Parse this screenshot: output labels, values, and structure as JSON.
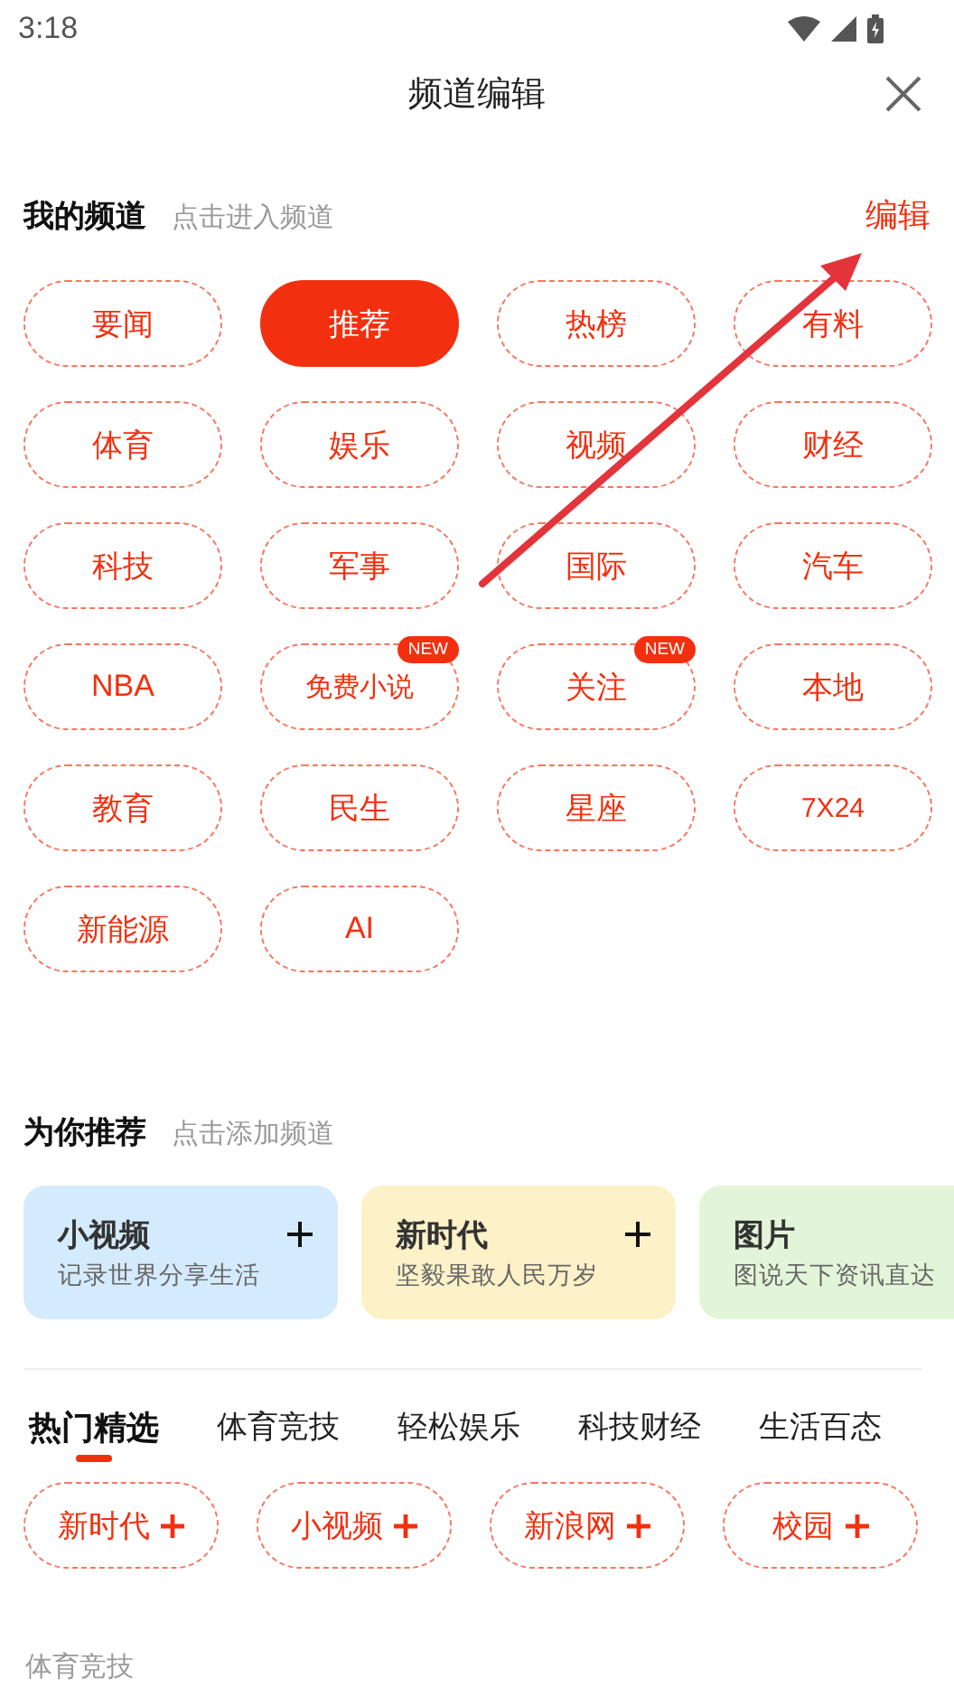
{
  "status_bar": {
    "time": "3:18"
  },
  "header": {
    "title": "频道编辑"
  },
  "my_channels": {
    "title": "我的频道",
    "hint": "点击进入频道",
    "edit": "编辑",
    "items": [
      {
        "label": "要闻",
        "selected": false
      },
      {
        "label": "推荐",
        "selected": true
      },
      {
        "label": "热榜",
        "selected": false
      },
      {
        "label": "有料",
        "selected": false
      },
      {
        "label": "体育",
        "selected": false
      },
      {
        "label": "娱乐",
        "selected": false
      },
      {
        "label": "视频",
        "selected": false
      },
      {
        "label": "财经",
        "selected": false
      },
      {
        "label": "科技",
        "selected": false
      },
      {
        "label": "军事",
        "selected": false
      },
      {
        "label": "国际",
        "selected": false
      },
      {
        "label": "汽车",
        "selected": false
      },
      {
        "label": "NBA",
        "selected": false
      },
      {
        "label": "免费小说",
        "selected": false,
        "badge": "NEW"
      },
      {
        "label": "关注",
        "selected": false,
        "badge": "NEW"
      },
      {
        "label": "本地",
        "selected": false
      },
      {
        "label": "教育",
        "selected": false
      },
      {
        "label": "民生",
        "selected": false
      },
      {
        "label": "星座",
        "selected": false
      },
      {
        "label": "7X24",
        "selected": false
      },
      {
        "label": "新能源",
        "selected": false
      },
      {
        "label": "AI",
        "selected": false
      }
    ]
  },
  "recommend": {
    "title": "为你推荐",
    "hint": "点击添加频道",
    "cards": [
      {
        "title": "小视频",
        "subtitle": "记录世界分享生活",
        "color": "#d4ebfd",
        "addable": true
      },
      {
        "title": "新时代",
        "subtitle": "坚毅果敢人民万岁",
        "color": "#fdf1c8",
        "addable": true
      },
      {
        "title": "图片",
        "subtitle": "图说天下资讯直达",
        "color": "#e3f5d8"
      }
    ]
  },
  "categories": {
    "tabs": [
      {
        "label": "热门精选",
        "selected": true
      },
      {
        "label": "体育竞技",
        "selected": false
      },
      {
        "label": "轻松娱乐",
        "selected": false
      },
      {
        "label": "科技财经",
        "selected": false
      },
      {
        "label": "生活百态",
        "selected": false
      }
    ],
    "items": [
      "新时代",
      "小视频",
      "新浪网",
      "校园"
    ],
    "next_section": "体育竞技"
  }
}
